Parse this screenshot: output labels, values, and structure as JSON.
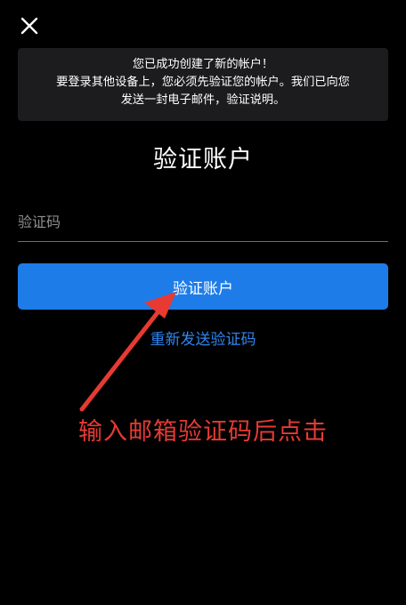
{
  "notice": {
    "lines": [
      "您已成功创建了新的帐户！",
      "要登录其他设备上，您必须先验证您的帐户。我们已向您",
      "发送一封电子邮件，验证说明。"
    ]
  },
  "page": {
    "title": "验证账户"
  },
  "form": {
    "code_placeholder": "验证码",
    "code_value": "",
    "verify_label": "验证账户",
    "resend_label": "重新发送验证码"
  },
  "annotation": {
    "text": "输入邮箱验证码后点击"
  },
  "colors": {
    "background": "#000000",
    "notice_bg": "#1c1c1e",
    "primary_button": "#1e7ce8",
    "link": "#2f86f0",
    "annotation": "#e63a33"
  },
  "icons": {
    "close": "close-icon",
    "arrow": "arrow-icon"
  }
}
